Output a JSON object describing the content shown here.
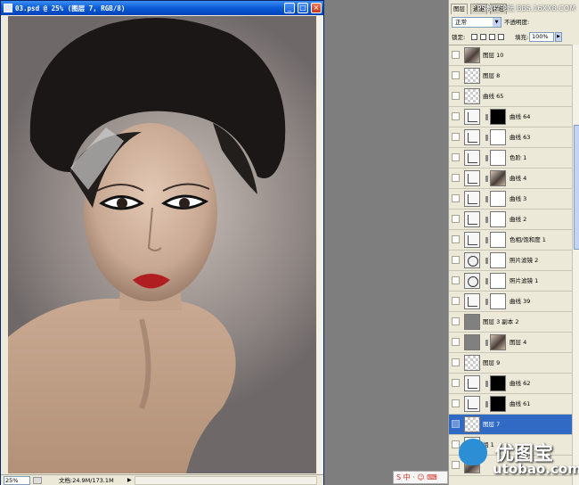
{
  "document": {
    "title": "03.psd @ 25% (图层 7, RGB/8)",
    "zoom": "25%",
    "doc_size": "文档:24.9M/173.1M",
    "buttons": {
      "minimize": "_",
      "maximize": "□",
      "close": "×"
    }
  },
  "panel": {
    "tabs": [
      "图层",
      "通道",
      "路径"
    ],
    "blend_mode": "正常",
    "opacity_label": "不透明度:",
    "lock_label": "锁定:",
    "fill_label": "填充:",
    "fill_value": "100%",
    "layers": [
      {
        "name": "图层 10",
        "thumb": "image"
      },
      {
        "name": "图层 8",
        "thumb": "transparent"
      },
      {
        "name": "曲线 65",
        "thumb": "transparent"
      },
      {
        "name": "曲线 64",
        "thumb": "curves",
        "mask": "black"
      },
      {
        "name": "曲线 63",
        "thumb": "curves",
        "mask": "white"
      },
      {
        "name": "色阶 1",
        "thumb": "levels",
        "mask": "white"
      },
      {
        "name": "曲线 4",
        "thumb": "curves",
        "mask": "image"
      },
      {
        "name": "曲线 3",
        "thumb": "curves",
        "mask": "white"
      },
      {
        "name": "曲线 2",
        "thumb": "curves",
        "mask": "white"
      },
      {
        "name": "色相/饱和度 1",
        "thumb": "hue",
        "mask": "white"
      },
      {
        "name": "照片滤镜 2",
        "thumb": "photo",
        "mask": "white"
      },
      {
        "name": "照片滤镜 1",
        "thumb": "photo",
        "mask": "white"
      },
      {
        "name": "曲线 39",
        "thumb": "curves",
        "mask": "white"
      },
      {
        "name": "图层 3 副本 2",
        "thumb": "gray"
      },
      {
        "name": "图层 4",
        "thumb": "gray",
        "mask": "image"
      },
      {
        "name": "图层 9",
        "thumb": "transparent"
      },
      {
        "name": "曲线 62",
        "thumb": "curves",
        "mask": "black"
      },
      {
        "name": "曲线 61",
        "thumb": "curves",
        "mask": "black"
      },
      {
        "name": "图层 7",
        "thumb": "transparent",
        "selected": true
      },
      {
        "name": "组 1",
        "thumb": "folder"
      },
      {
        "name": "",
        "thumb": "image"
      }
    ]
  },
  "watermark": "PS教程论坛 BBS.16XX8.COM",
  "brand": {
    "name": "优图宝",
    "url": "utobao.com"
  },
  "ime": "S 中 · ☺ ⌨"
}
